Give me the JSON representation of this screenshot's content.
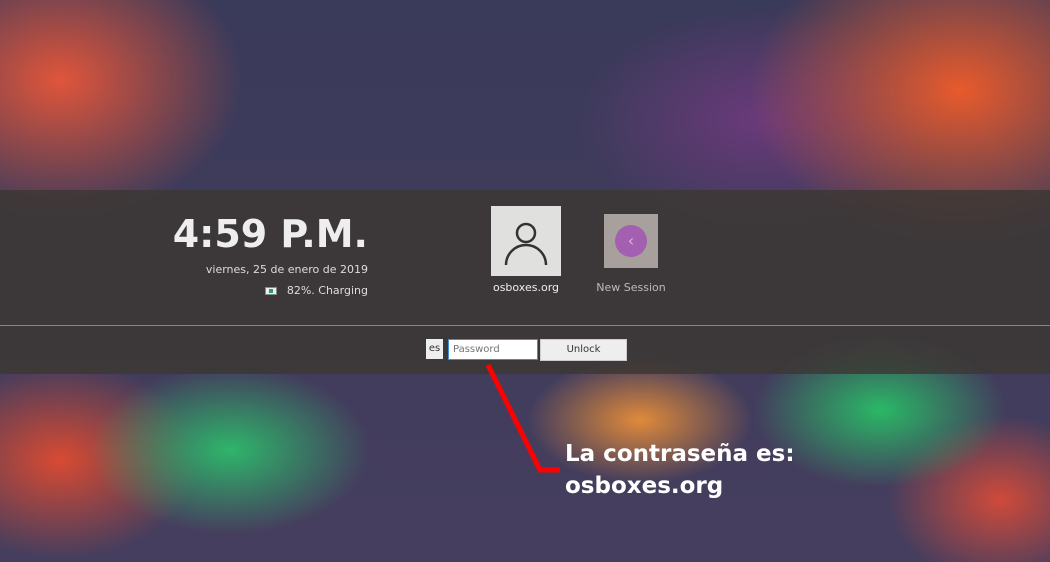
{
  "clock": {
    "time": "4:59 P.M.",
    "date": "viernes, 25 de enero de 2019"
  },
  "battery": {
    "text": "82%. Charging",
    "percent": 82
  },
  "users": [
    {
      "name": "osboxes.org",
      "icon": "user-icon"
    },
    {
      "name": "New Session",
      "icon": "back-arrow-icon"
    }
  ],
  "login": {
    "keyboard_layout": "es",
    "password_placeholder": "Password",
    "password_value": "",
    "unlock_label": "Unlock"
  },
  "annotation": {
    "line1": "La contraseña es:",
    "line2": "osboxes.org",
    "color": "#ff0000"
  }
}
